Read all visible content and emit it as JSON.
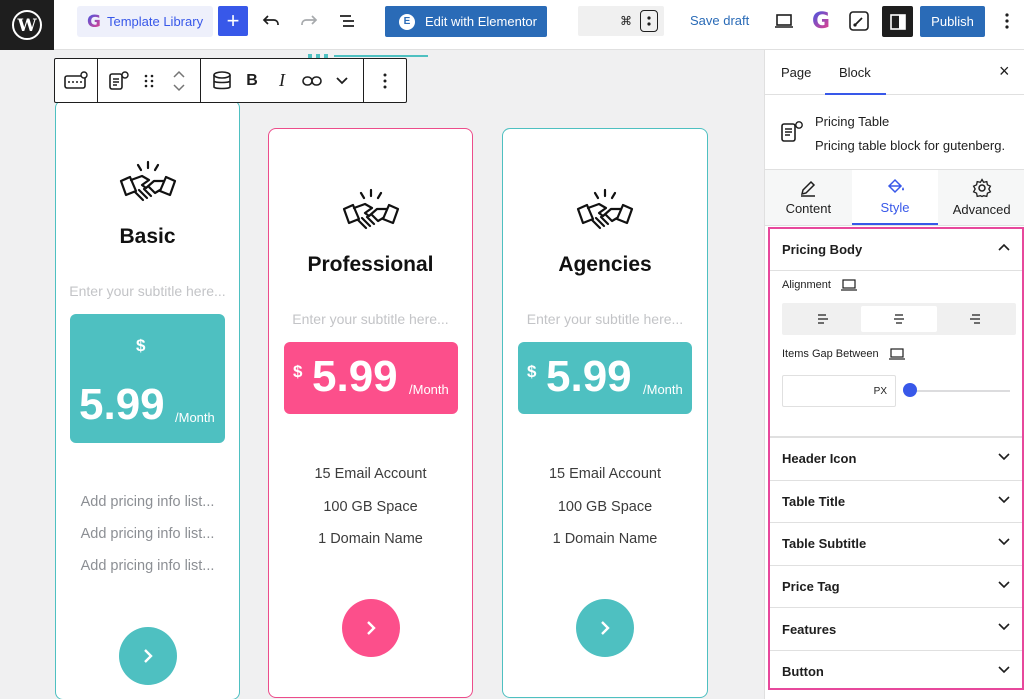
{
  "topbar": {
    "template_library": "Template Library",
    "add_label": "+",
    "edit_elementor": "Edit with Elementor",
    "cmd_symbol": "⌘",
    "save_draft": "Save draft",
    "publish": "Publish"
  },
  "cards": {
    "basic": {
      "title": "Basic",
      "subtitle_placeholder": "Enter your subtitle here...",
      "currency": "$",
      "price": "5.99",
      "period": "/Month",
      "features": [
        "Add pricing info list...",
        "Add pricing info list...",
        "Add pricing info list..."
      ],
      "button_icon": "chevron-right-icon"
    },
    "professional": {
      "title": "Professional",
      "subtitle_placeholder": "Enter your subtitle here...",
      "currency": "$",
      "price": "5.99",
      "period": "/Month",
      "features": [
        "15 Email Account",
        "100 GB Space",
        "1 Domain Name"
      ],
      "button_icon": "chevron-right-icon"
    },
    "agencies": {
      "title": "Agencies",
      "subtitle_placeholder": "Enter your subtitle here...",
      "currency": "$",
      "price": "5.99",
      "period": "/Month",
      "features": [
        "15 Email Account",
        "100 GB Space",
        "1 Domain Name"
      ],
      "button_icon": "chevron-right-icon"
    }
  },
  "colors": {
    "teal": "#4ec0c1",
    "pink": "#fc4f8b",
    "accent": "#3858e9",
    "highlight": "#e7489c"
  },
  "sidebar": {
    "tab_page": "Page",
    "tab_block": "Block",
    "close": "×",
    "block_title": "Pricing Table",
    "block_desc": "Pricing table block for gutenberg.",
    "tabs": {
      "content": "Content",
      "style": "Style",
      "advanced": "Advanced"
    },
    "pricing_body": {
      "title": "Pricing Body",
      "alignment_label": "Alignment",
      "items_gap_label": "Items Gap Between",
      "gap_unit": "PX",
      "gap_value": 0
    },
    "sections": [
      "Header Icon",
      "Table Title",
      "Table Subtitle",
      "Price Tag",
      "Features",
      "Button"
    ]
  }
}
